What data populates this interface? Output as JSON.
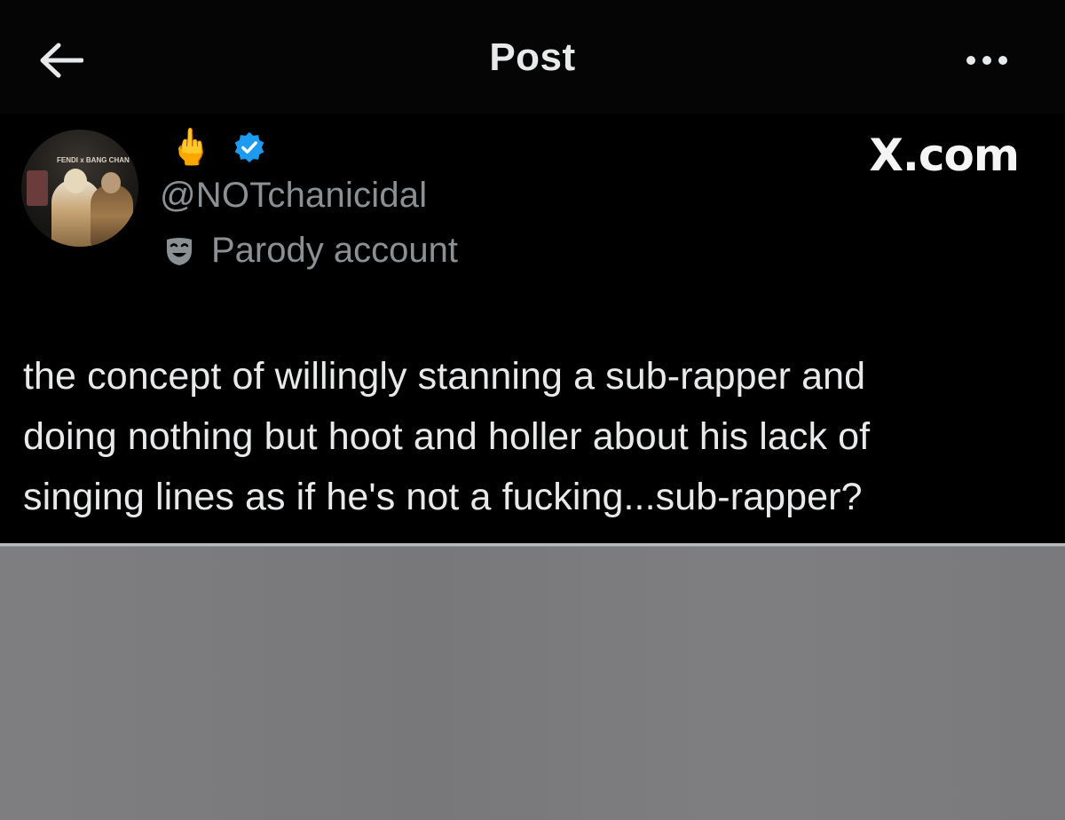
{
  "header": {
    "back_icon": "arrow-left-icon",
    "title": "Post",
    "more_icon": "more-horizontal-icon"
  },
  "author": {
    "display_name": "🖕",
    "verified_icon": "verified-badge-icon",
    "verified_color": "#1d9bf0",
    "handle": "@NOTchanicidal",
    "label_icon": "parody-mask-icon",
    "label": "Parody account",
    "avatar_caption": "FENDI x BANG CHAN"
  },
  "watermark": "X.com",
  "post": {
    "lines": [
      "the concept of willingly stanning a sub-rapper and",
      "doing nothing but hoot and holler about his lack of",
      "singing lines as if he's not a fucking...sub-rapper?"
    ]
  },
  "colors": {
    "background": "#000000",
    "text_primary": "#e7e9ea",
    "text_secondary": "#8b9094",
    "gray_area": "#7c7c7e"
  }
}
